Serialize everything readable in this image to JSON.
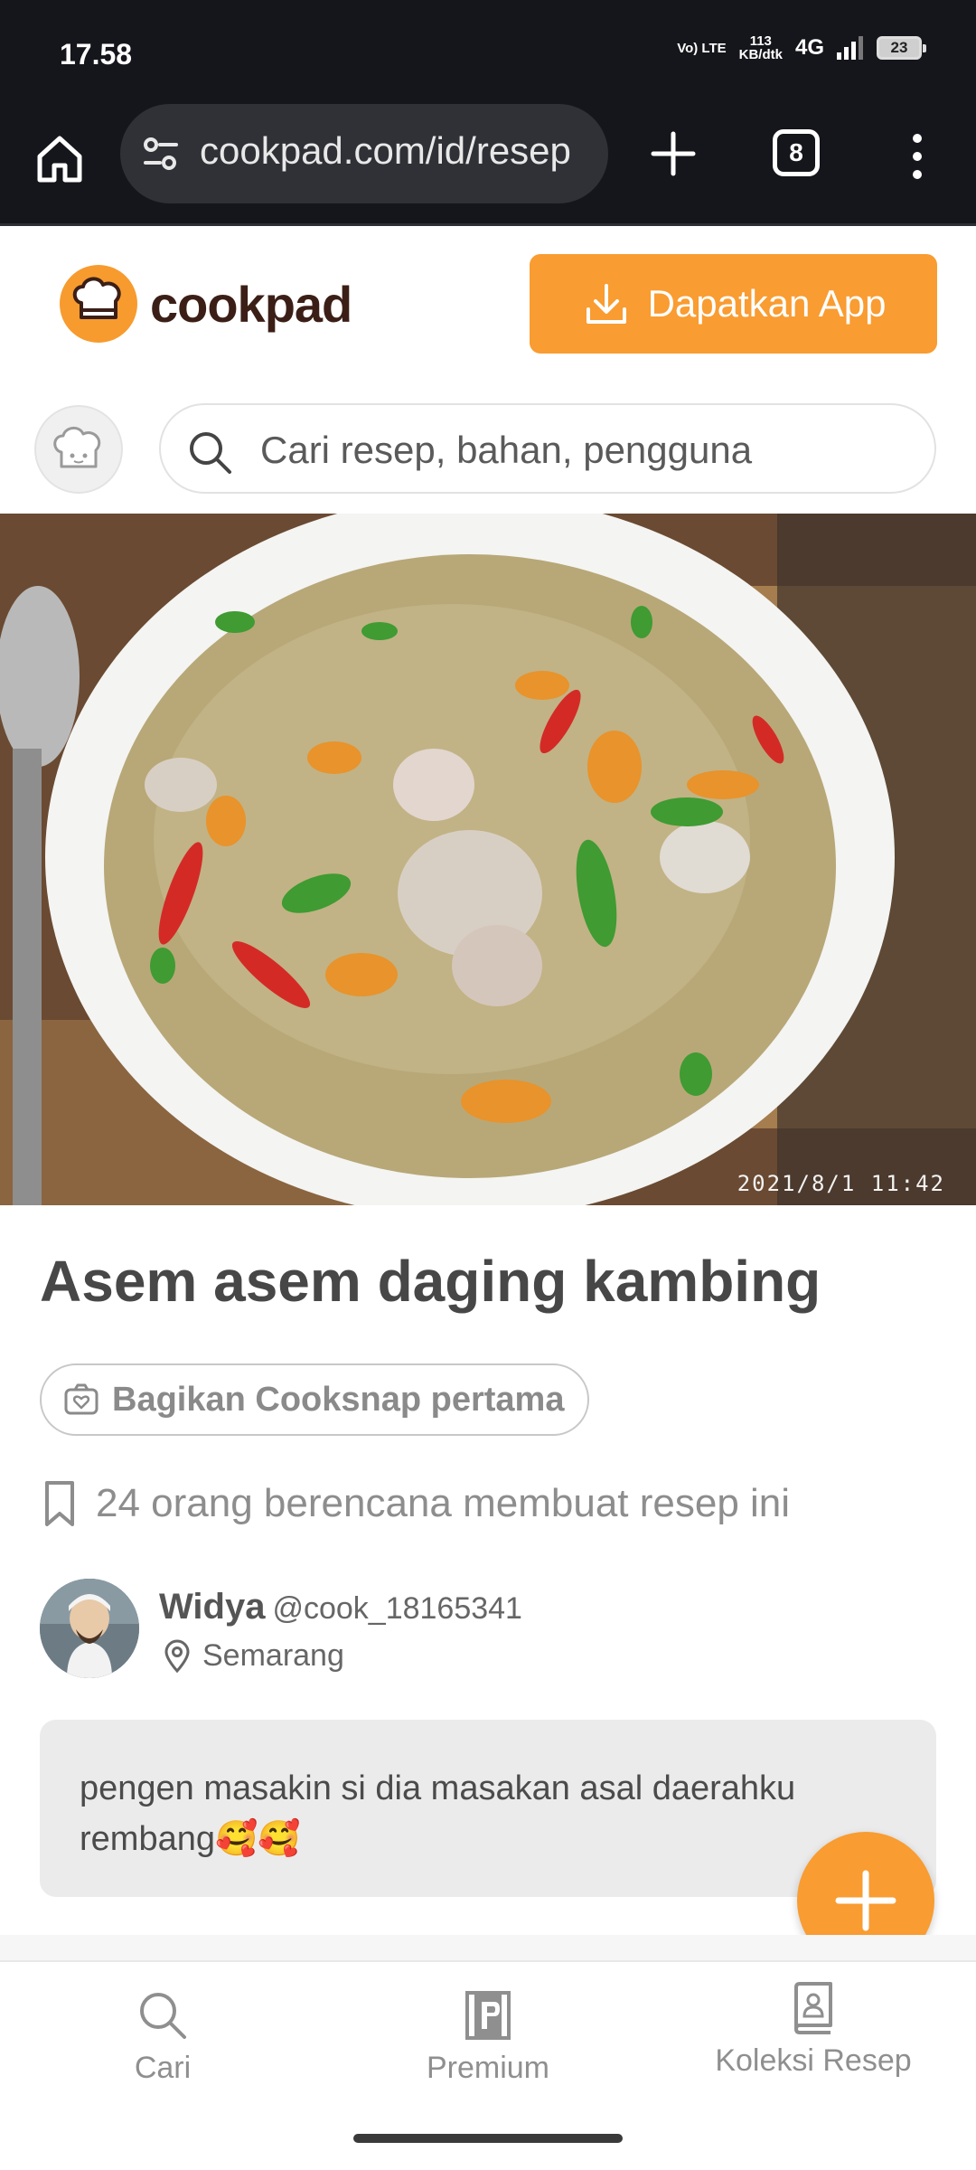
{
  "status_bar": {
    "time": "17.58",
    "network_type": "Vo) LTE",
    "data_speed": "113",
    "data_speed_unit": "KB/dtk",
    "network_gen": "4G",
    "battery": "23"
  },
  "browser": {
    "url": "cookpad.com/id/resep",
    "tab_count": "8",
    "icons": [
      "home-icon",
      "site-settings-icon",
      "new-tab-icon",
      "tabs-icon",
      "more-menu-icon"
    ]
  },
  "header": {
    "logo_text": "cookpad",
    "get_app_label": "Dapatkan App",
    "brand_color": "#f99c31"
  },
  "search": {
    "placeholder": "Cari resep, bahan, pengguna"
  },
  "recipe": {
    "photo_timestamp": "2021/8/1  11:42",
    "title": "Asem asem daging kambing",
    "cooksnap_label": "Bagikan Cooksnap pertama",
    "planning_text": "24 orang berencana membuat resep ini",
    "author": {
      "name": "Widya",
      "handle": "@cook_18165341",
      "location": "Semarang"
    },
    "story": "pengen masakin si dia masakan asal daerahku rembang🥰🥰"
  },
  "bottom_nav": {
    "items": [
      {
        "label": "Cari",
        "icon": "search-icon"
      },
      {
        "label": "Premium",
        "icon": "premium-icon"
      },
      {
        "label": "Koleksi Resep",
        "icon": "collection-icon"
      }
    ]
  }
}
